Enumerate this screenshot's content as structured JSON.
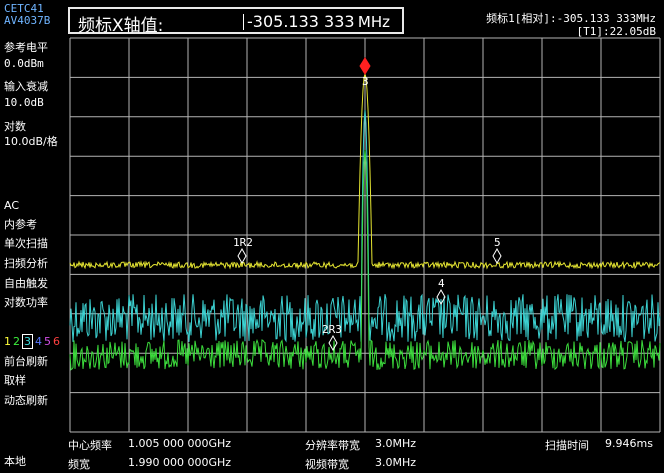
{
  "header": {
    "brand_line1": "CETC41",
    "brand_line2": "AV4037B",
    "marker_input_label": "频标X轴值:",
    "marker_input_value": "-305.133 333",
    "marker_input_unit": "MHz",
    "marker_readout_line1": "频标1[相对]:-305.133 333MHz",
    "marker_readout_line2": "[T1]:22.05dB"
  },
  "sidebar": {
    "ref_level_label": "参考电平",
    "ref_level_value": "0.0dBm",
    "atten_label": "输入衰减",
    "atten_value": "10.0dB",
    "scale_label": "对数",
    "scale_value": "10.0dB/格",
    "coupling": "AC",
    "reference": "内参考",
    "sweep_mode": "单次扫描",
    "sweep_analysis": "扫频分析",
    "trigger": "自由触发",
    "detector_power": "对数功率",
    "traces": [
      {
        "label": "1",
        "color": "#ffff3c"
      },
      {
        "label": "2",
        "color": "#3cf03c"
      },
      {
        "label": "3",
        "color": "#3cdcdc"
      },
      {
        "label": "4",
        "color": "#5a78ff"
      },
      {
        "label": "5",
        "color": "#d24ee6"
      },
      {
        "label": "6",
        "color": "#ff4040"
      }
    ],
    "refresh_fg": "前台刷新",
    "sampling": "取样",
    "dynamic_refresh": "动态刷新",
    "local": "本地"
  },
  "markers": {
    "m1r2": "1R2",
    "m2r3": "2R3",
    "m3": "3",
    "m4": "4",
    "m5": "5"
  },
  "footer": {
    "center_freq_label": "中心频率",
    "center_freq_value": "1.005 000 000GHz",
    "span_label": "频宽",
    "span_value": "1.990 000 000GHz",
    "rbw_label": "分辨率带宽",
    "rbw_value": "3.0MHz",
    "vbw_label": "视频带宽",
    "vbw_value": "3.0MHz",
    "sweep_time_label": "扫描时间",
    "sweep_time_value": "9.946ms"
  },
  "colors": {
    "grid": "#b4b4b4",
    "trace1": "#e6e632",
    "trace2": "#3cdc3c",
    "trace3": "#3cd2d2",
    "active_marker": "#ff2020"
  }
}
